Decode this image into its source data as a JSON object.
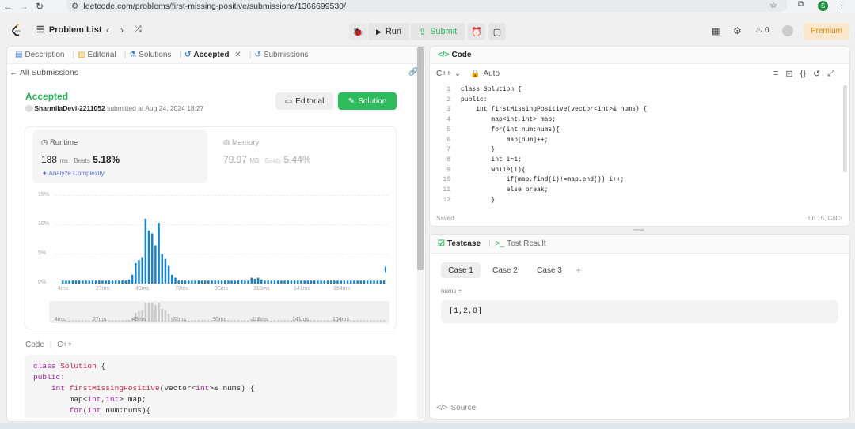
{
  "browser": {
    "url": "leetcode.com/problems/first-missing-positive/submissions/1366699530/",
    "profile_initial": "S"
  },
  "toolbar": {
    "problem_list": "Problem List",
    "run": "Run",
    "submit": "Submit",
    "streak": "0",
    "premium": "Premium"
  },
  "left": {
    "tabs": [
      {
        "label": "Description",
        "icon": "description-icon"
      },
      {
        "label": "Editorial",
        "icon": "book-icon"
      },
      {
        "label": "Solutions",
        "icon": "flask-icon"
      },
      {
        "label": "Accepted",
        "icon": "history-icon",
        "active": true
      },
      {
        "label": "Submissions",
        "icon": "history-icon"
      }
    ],
    "all_submissions": "All Submissions",
    "status": "Accepted",
    "user": "SharmilaDevi-2211052",
    "submitted_at": "submitted at Aug 24, 2024 18:27",
    "editorial_btn": "Editorial",
    "solution_btn": "Solution",
    "runtime": {
      "label": "Runtime",
      "value": "188",
      "unit": "ms",
      "beats_label": "Beats",
      "beats": "5.18%"
    },
    "memory": {
      "label": "Memory",
      "value": "79.97",
      "unit": "MB",
      "beats_label": "Beats",
      "beats": "5.44%"
    },
    "analyze": "Analyze Complexity",
    "code_label": "Code",
    "code_lang": "C++",
    "code_lines": [
      "class Solution {",
      "public:",
      "    int firstMissingPositive(vector<int>& nums) {",
      "        map<int,int> map;",
      "        for(int num:nums){"
    ]
  },
  "chart_data": {
    "type": "bar",
    "ylim": [
      0,
      15
    ],
    "yticks": [
      "15%",
      "10%",
      "5%",
      "0%"
    ],
    "xticks": [
      "4ms",
      "27ms",
      "49ms",
      "72ms",
      "95ms",
      "118ms",
      "141ms",
      "164ms"
    ],
    "values": [
      0.5,
      0.5,
      0.5,
      0.5,
      0.5,
      0.5,
      0.5,
      0.5,
      0.5,
      0.5,
      0.5,
      0.5,
      0.5,
      0.5,
      0.5,
      0.5,
      0.5,
      0.5,
      0.5,
      0.5,
      0.7,
      1.5,
      3.5,
      4,
      4.5,
      11,
      9,
      8.5,
      6.5,
      10.3,
      5,
      4.2,
      3,
      1.5,
      1,
      0.5,
      0.5,
      0.5,
      0.5,
      0.5,
      0.5,
      0.5,
      0.5,
      0.5,
      0.5,
      0.5,
      0.5,
      0.5,
      0.5,
      0.5,
      0.5,
      0.5,
      0.5,
      0.5,
      0.6,
      0.5,
      0.5,
      1,
      0.8,
      1,
      0.7,
      0.5,
      0.5,
      0.5,
      0.5,
      0.5,
      0.5,
      0.5,
      0.5,
      0.5,
      0.5,
      0.5,
      0.5,
      0.5,
      0.5,
      0.5,
      0.5,
      0.5,
      0.5,
      0.5,
      0.5,
      0.5,
      0.5,
      0.5,
      0.5,
      0.5,
      0.5,
      0.5,
      0.5,
      0.5,
      0.5,
      0.5,
      0.5,
      0.5,
      0.5,
      0.5,
      0.5,
      0.5
    ],
    "color": "#1a82c9",
    "highlight_index": 99
  },
  "right": {
    "code_title": "Code",
    "lang": "C++",
    "auto": "Auto",
    "lines": [
      "class Solution {",
      "public:",
      "    int firstMissingPositive(vector<int>& nums) {",
      "        map<int,int> map;",
      "        for(int num:nums){",
      "            map[num]++;",
      "        }",
      "        int i=1;",
      "        while(i){",
      "            if(map.find(i)!=map.end()) i++;",
      "            else break;",
      "        }"
    ],
    "line_numbers": [
      "1",
      "2",
      "3",
      "4",
      "5",
      "6",
      "7",
      "8",
      "9",
      "10",
      "11",
      "12"
    ],
    "saved": "Saved",
    "cursor": "Ln 15, Col 3",
    "testcase_tab": "Testcase",
    "result_tab": "Test Result",
    "cases": [
      "Case 1",
      "Case 2",
      "Case 3"
    ],
    "add_case": "+",
    "input_label": "nums =",
    "input_value": "[1,2,0]",
    "source": "Source"
  }
}
